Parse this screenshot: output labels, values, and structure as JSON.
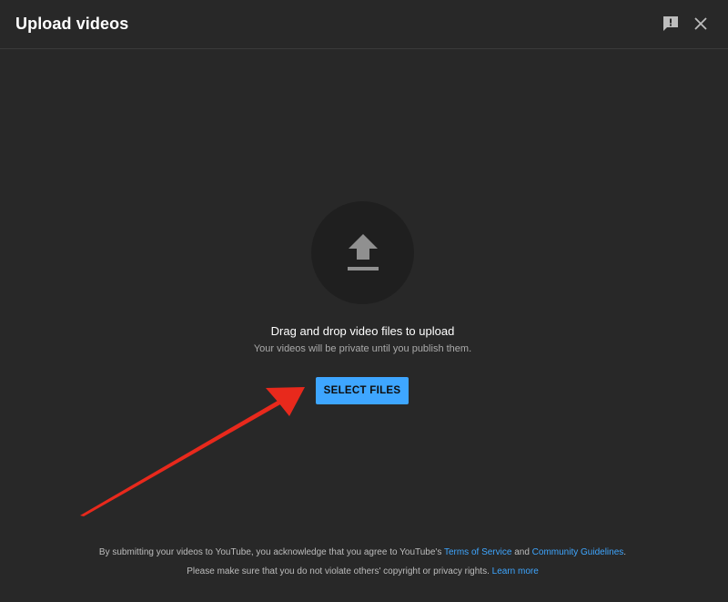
{
  "dialog": {
    "title": "Upload videos"
  },
  "header": {
    "feedback_icon": "feedback-icon",
    "close_icon": "close-icon"
  },
  "dropzone": {
    "icon": "upload-arrow-icon",
    "heading": "Drag and drop video files to upload",
    "subtext": "Your videos will be private until you publish them.",
    "select_button_label": "SELECT FILES"
  },
  "annotation": {
    "arrow_color": "#e8291c"
  },
  "footer": {
    "line1_prefix": "By submitting your videos to YouTube, you acknowledge that you agree to YouTube's ",
    "terms_link": "Terms of Service",
    "line1_and": " and ",
    "guidelines_link": "Community Guidelines",
    "line1_suffix": ".",
    "line2_prefix": "Please make sure that you do not violate others' copyright or privacy rights. ",
    "learn_more_link": "Learn more"
  },
  "colors": {
    "background": "#282828",
    "accent": "#3ea6ff",
    "circle": "#1f1f1f"
  }
}
